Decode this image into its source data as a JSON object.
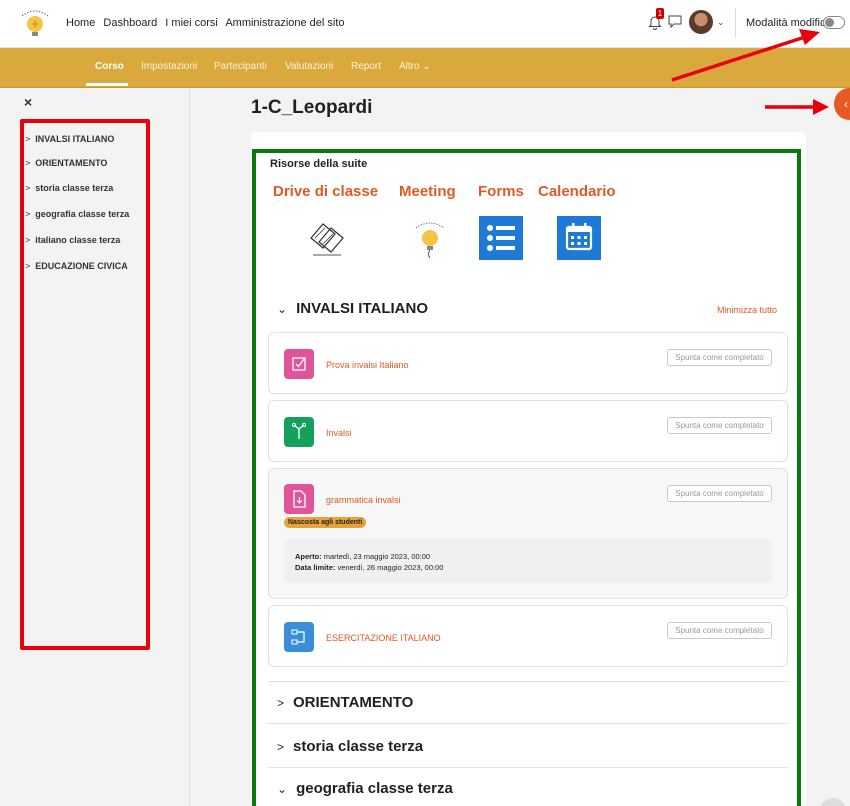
{
  "navbar": {
    "links": [
      "Home",
      "Dashboard",
      "I miei corsi",
      "Amministrazione del sito"
    ],
    "notification_count": "1",
    "edit_mode_label": "Modalità modifica"
  },
  "subnav": {
    "tabs": [
      "Corso",
      "Impostazioni",
      "Partecipanti",
      "Valutazioni",
      "Report",
      "Altro"
    ],
    "active": "Corso",
    "more_chevron": "⌄"
  },
  "drawer": {
    "close_label": "×",
    "items": [
      "INVALSI ITALIANO",
      "ORIENTAMENTO",
      "storia classe terza",
      "geografia classe terza",
      "italiano classe terza",
      "EDUCAZIONE CIVICA"
    ]
  },
  "page": {
    "title": "1-C_Leopardi",
    "resources_title": "Risorse della suite",
    "suite_links": [
      "Drive di classe",
      "Meeting",
      "Forms",
      "Calendario"
    ],
    "suite_icons": [
      "continuity-logo-icon",
      "lightbulb-logo-icon",
      "forms-list-icon",
      "calendar-icon"
    ]
  },
  "sections": [
    {
      "title": "INVALSI ITALIANO",
      "expanded": true
    },
    {
      "title": "ORIENTAMENTO",
      "expanded": false
    },
    {
      "title": "storia classe terza",
      "expanded": false
    },
    {
      "title": "geografia classe terza",
      "expanded": true
    }
  ],
  "minimize_label": "Minimizza tutto",
  "activities": [
    {
      "name": "Prova invalsi Italiano",
      "icon": "assignment-icon",
      "color": "#e0559a",
      "button": "Spunta come completato"
    },
    {
      "name": "Invalsi",
      "icon": "feedback-icon",
      "color": "#16a05d",
      "button": "Spunta come completato"
    },
    {
      "name": "grammatica invalsi",
      "icon": "file-icon",
      "color": "#e0559a",
      "button": "Spunta come completato",
      "badge": "Nascosta agli studenti",
      "open_label": "Aperto:",
      "open_value": "martedì, 23 maggio 2023, 00:00",
      "due_label": "Data limite:",
      "due_value": "venerdì, 26 maggio 2023, 00:00"
    },
    {
      "name": "ESERCITAZIONE ITALIANO",
      "icon": "lesson-icon",
      "color": "#3a8ed8",
      "button": "Spunta come completato"
    }
  ],
  "colors": {
    "accent": "#e05a24",
    "subnav": "#d9a93d",
    "highlight_red": "#e8000b",
    "highlight_green": "#0a7a0a"
  }
}
